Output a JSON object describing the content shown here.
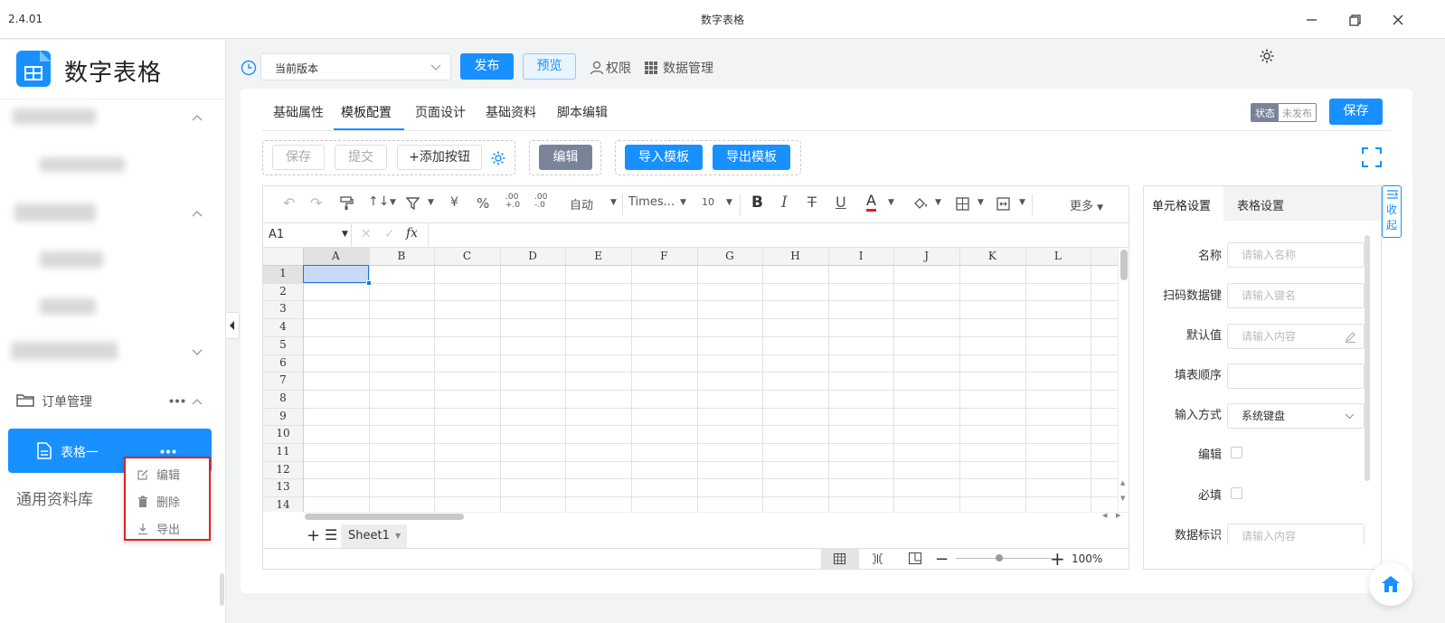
{
  "window": {
    "version": "2.4.01",
    "title": "数字表格"
  },
  "sidebar": {
    "logo_text": "数字表格",
    "folder_label": "订单管理",
    "active_item": "表格一",
    "library_label": "通用资料库",
    "context_menu": [
      {
        "label": "编辑",
        "icon": "edit-icon"
      },
      {
        "label": "删除",
        "icon": "trash-icon"
      },
      {
        "label": "导出",
        "icon": "download-icon"
      }
    ]
  },
  "topbar": {
    "version_select": "当前版本",
    "publish": "发布",
    "preview": "预览",
    "permission": "权限",
    "data_manage": "数据管理"
  },
  "tabs": [
    "基础属性",
    "模板配置",
    "页面设计",
    "基础资料",
    "脚本编辑"
  ],
  "active_tab": 1,
  "status": {
    "label": "状态",
    "value": "未发布"
  },
  "save_label": "保存",
  "action_buttons": {
    "save": "保存",
    "submit": "提交",
    "add_button": "+添加按钮",
    "edit": "编辑",
    "import_template": "导入模板",
    "export_template": "导出模板"
  },
  "toolbar": {
    "currency": "¥",
    "percent": "%",
    "dec_add": ".00",
    "dec_remove": ".00",
    "format": "自动",
    "font": "Times...",
    "size": "10",
    "bold": "B",
    "italic": "I",
    "strike": "T",
    "underline": "U",
    "font_color": "A",
    "more": "更多"
  },
  "formula": {
    "cell_ref": "A1",
    "fx": "fx"
  },
  "columns": [
    "A",
    "B",
    "C",
    "D",
    "E",
    "F",
    "G",
    "H",
    "I",
    "J",
    "K",
    "L"
  ],
  "rows": [
    "1",
    "2",
    "3",
    "4",
    "5",
    "6",
    "7",
    "8",
    "9",
    "10",
    "11",
    "12",
    "13",
    "14"
  ],
  "sheet_tab": "Sheet1",
  "zoom": "100%",
  "panel": {
    "tabs": [
      "单元格设置",
      "表格设置"
    ],
    "collapse": "收起",
    "fields": {
      "name_label": "名称",
      "name_placeholder": "请输入名称",
      "scan_label": "扫码数据键",
      "scan_placeholder": "请输入键名",
      "default_label": "默认值",
      "default_placeholder": "请输入内容",
      "order_label": "填表顺序",
      "input_label": "输入方式",
      "input_value": "系统键盘",
      "edit_label": "编辑",
      "required_label": "必填",
      "tag_label": "数据标识",
      "tag_placeholder": "请输入内容"
    }
  },
  "colors": {
    "primary": "#1890ff",
    "danger": "#e02020",
    "edit_btn": "#7a8499"
  }
}
